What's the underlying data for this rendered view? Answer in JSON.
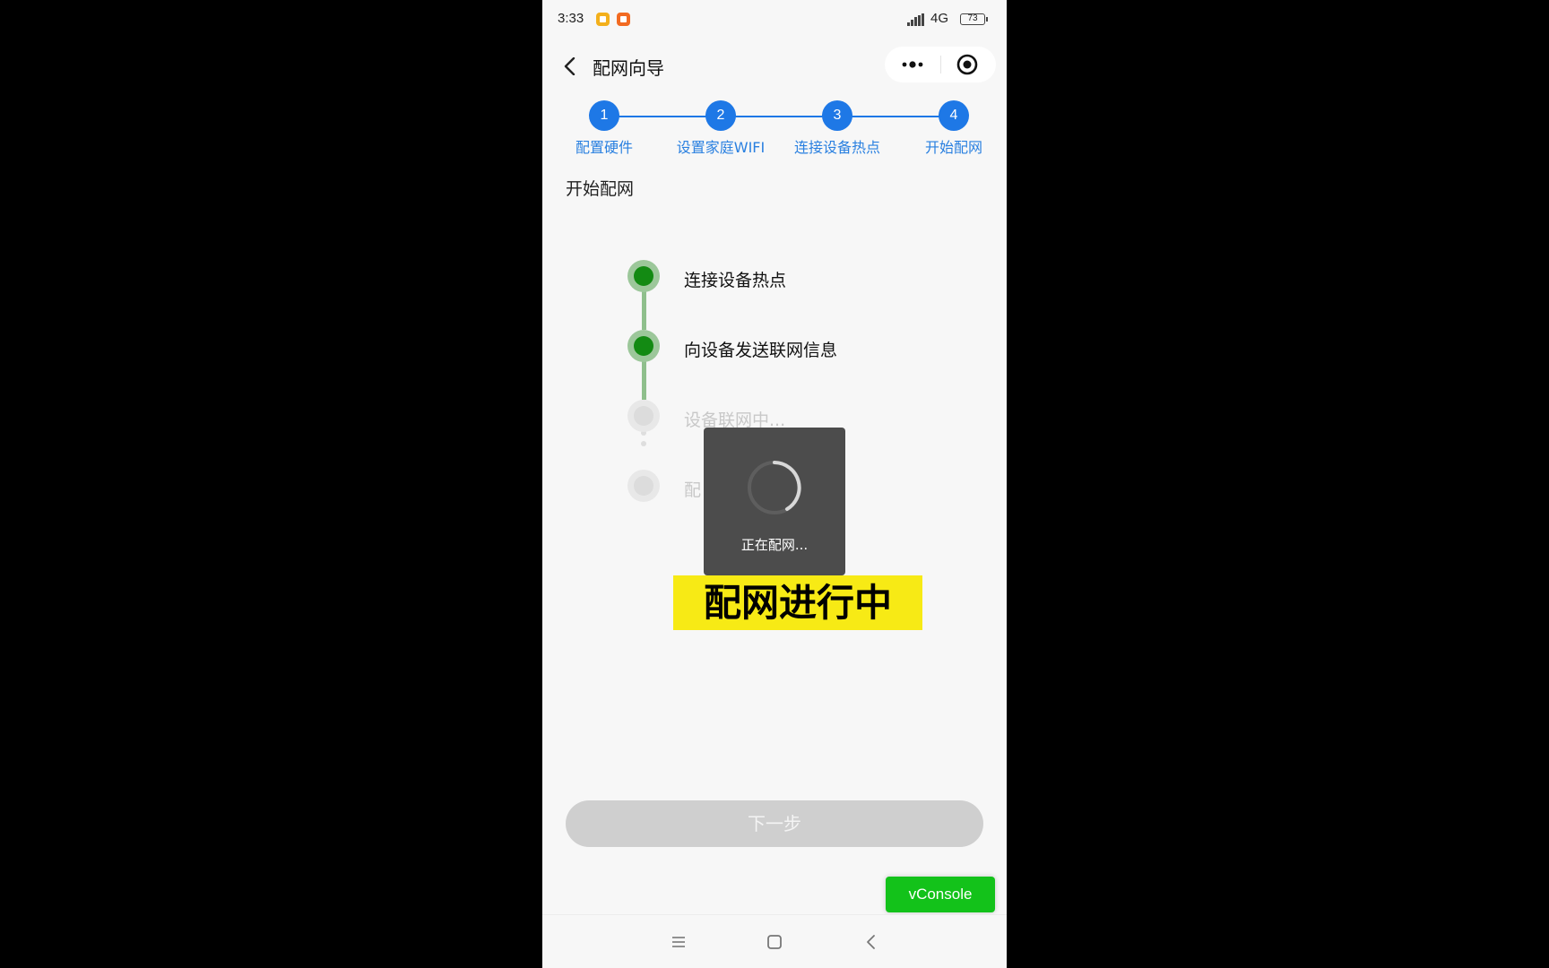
{
  "status_bar": {
    "time": "3:33",
    "network": "4G",
    "battery": "73"
  },
  "nav": {
    "title": "配网向导"
  },
  "stepper": {
    "steps": [
      {
        "number": "1",
        "label": "配置硬件"
      },
      {
        "number": "2",
        "label": "设置家庭WIFI"
      },
      {
        "number": "3",
        "label": "连接设备热点"
      },
      {
        "number": "4",
        "label": "开始配网"
      }
    ]
  },
  "section": {
    "title": "开始配网"
  },
  "timeline": {
    "items": [
      {
        "label": "连接设备热点",
        "state": "done"
      },
      {
        "label": "向设备发送联网信息",
        "state": "done"
      },
      {
        "label": "设备联网中...",
        "state": "pending"
      },
      {
        "label": "配",
        "state": "pending"
      }
    ]
  },
  "toast": {
    "text": "正在配网..."
  },
  "caption": {
    "text": "配网进行中"
  },
  "next_button": {
    "label": "下一步"
  },
  "vconsole": {
    "label": "vConsole"
  },
  "colors": {
    "accent_blue": "#1e78e6",
    "done_green": "#138a13",
    "caption_yellow": "#f7ea15",
    "vconsole_green": "#13c21a"
  },
  "icons": {
    "back": "chevron-left-icon",
    "more": "more-dots-icon",
    "target": "target-icon",
    "menu": "menu-icon",
    "home": "home-square-icon",
    "nav_back": "nav-back-icon"
  }
}
